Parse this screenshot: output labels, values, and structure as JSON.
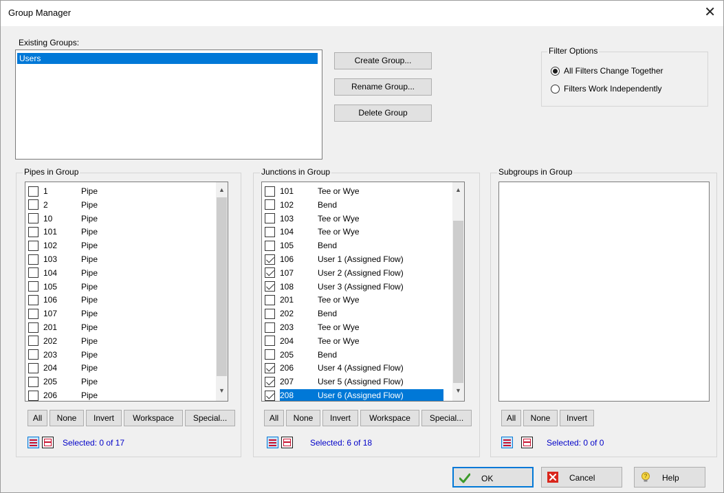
{
  "window": {
    "title": "Group Manager"
  },
  "existing_groups": {
    "label": "Existing Groups:",
    "items": [
      "Users"
    ]
  },
  "group_buttons": {
    "create": "Create Group...",
    "rename": "Rename Group...",
    "delete": "Delete Group"
  },
  "filter_options": {
    "title": "Filter Options",
    "options": [
      {
        "label": "All Filters Change Together",
        "selected": true
      },
      {
        "label": "Filters Work Independently",
        "selected": false
      }
    ]
  },
  "pipes": {
    "title": "Pipes in Group",
    "rows": [
      {
        "id": "1",
        "name": "Pipe",
        "checked": false
      },
      {
        "id": "2",
        "name": "Pipe",
        "checked": false
      },
      {
        "id": "10",
        "name": "Pipe",
        "checked": false
      },
      {
        "id": "101",
        "name": "Pipe",
        "checked": false
      },
      {
        "id": "102",
        "name": "Pipe",
        "checked": false
      },
      {
        "id": "103",
        "name": "Pipe",
        "checked": false
      },
      {
        "id": "104",
        "name": "Pipe",
        "checked": false
      },
      {
        "id": "105",
        "name": "Pipe",
        "checked": false
      },
      {
        "id": "106",
        "name": "Pipe",
        "checked": false
      },
      {
        "id": "107",
        "name": "Pipe",
        "checked": false
      },
      {
        "id": "201",
        "name": "Pipe",
        "checked": false
      },
      {
        "id": "202",
        "name": "Pipe",
        "checked": false
      },
      {
        "id": "203",
        "name": "Pipe",
        "checked": false
      },
      {
        "id": "204",
        "name": "Pipe",
        "checked": false
      },
      {
        "id": "205",
        "name": "Pipe",
        "checked": false
      },
      {
        "id": "206",
        "name": "Pipe",
        "checked": false
      }
    ],
    "buttons": {
      "all": "All",
      "none": "None",
      "invert": "Invert",
      "workspace": "Workspace",
      "special": "Special..."
    },
    "status": "Selected: 0 of 17"
  },
  "junctions": {
    "title": "Junctions in Group",
    "rows": [
      {
        "id": "101",
        "name": "Tee or Wye",
        "checked": false,
        "selected": false
      },
      {
        "id": "102",
        "name": "Bend",
        "checked": false,
        "selected": false
      },
      {
        "id": "103",
        "name": "Tee or Wye",
        "checked": false,
        "selected": false
      },
      {
        "id": "104",
        "name": "Tee or Wye",
        "checked": false,
        "selected": false
      },
      {
        "id": "105",
        "name": "Bend",
        "checked": false,
        "selected": false
      },
      {
        "id": "106",
        "name": "User 1 (Assigned Flow)",
        "checked": true,
        "selected": false
      },
      {
        "id": "107",
        "name": "User 2 (Assigned Flow)",
        "checked": true,
        "selected": false
      },
      {
        "id": "108",
        "name": "User 3 (Assigned Flow)",
        "checked": true,
        "selected": false
      },
      {
        "id": "201",
        "name": "Tee or Wye",
        "checked": false,
        "selected": false
      },
      {
        "id": "202",
        "name": "Bend",
        "checked": false,
        "selected": false
      },
      {
        "id": "203",
        "name": "Tee or Wye",
        "checked": false,
        "selected": false
      },
      {
        "id": "204",
        "name": "Tee or Wye",
        "checked": false,
        "selected": false
      },
      {
        "id": "205",
        "name": "Bend",
        "checked": false,
        "selected": false
      },
      {
        "id": "206",
        "name": "User 4 (Assigned Flow)",
        "checked": true,
        "selected": false
      },
      {
        "id": "207",
        "name": "User 5 (Assigned Flow)",
        "checked": true,
        "selected": false
      },
      {
        "id": "208",
        "name": "User 6 (Assigned Flow)",
        "checked": true,
        "selected": true
      }
    ],
    "buttons": {
      "all": "All",
      "none": "None",
      "invert": "Invert",
      "workspace": "Workspace",
      "special": "Special..."
    },
    "status": "Selected: 6 of 18"
  },
  "subgroups": {
    "title": "Subgroups in Group",
    "buttons": {
      "all": "All",
      "none": "None",
      "invert": "Invert"
    },
    "status": "Selected: 0 of 0"
  },
  "footer": {
    "ok": "OK",
    "cancel": "Cancel",
    "help": "Help"
  },
  "colors": {
    "selection": "#0078d7",
    "status_text": "#0000c8",
    "check_ok": "#3c9a2a",
    "cancel_red": "#d9261c"
  },
  "icons": [
    "close-icon",
    "ok-check-icon",
    "cancel-x-icon",
    "help-lightbulb-icon",
    "show-all-rows-icon",
    "show-checked-only-icon"
  ]
}
